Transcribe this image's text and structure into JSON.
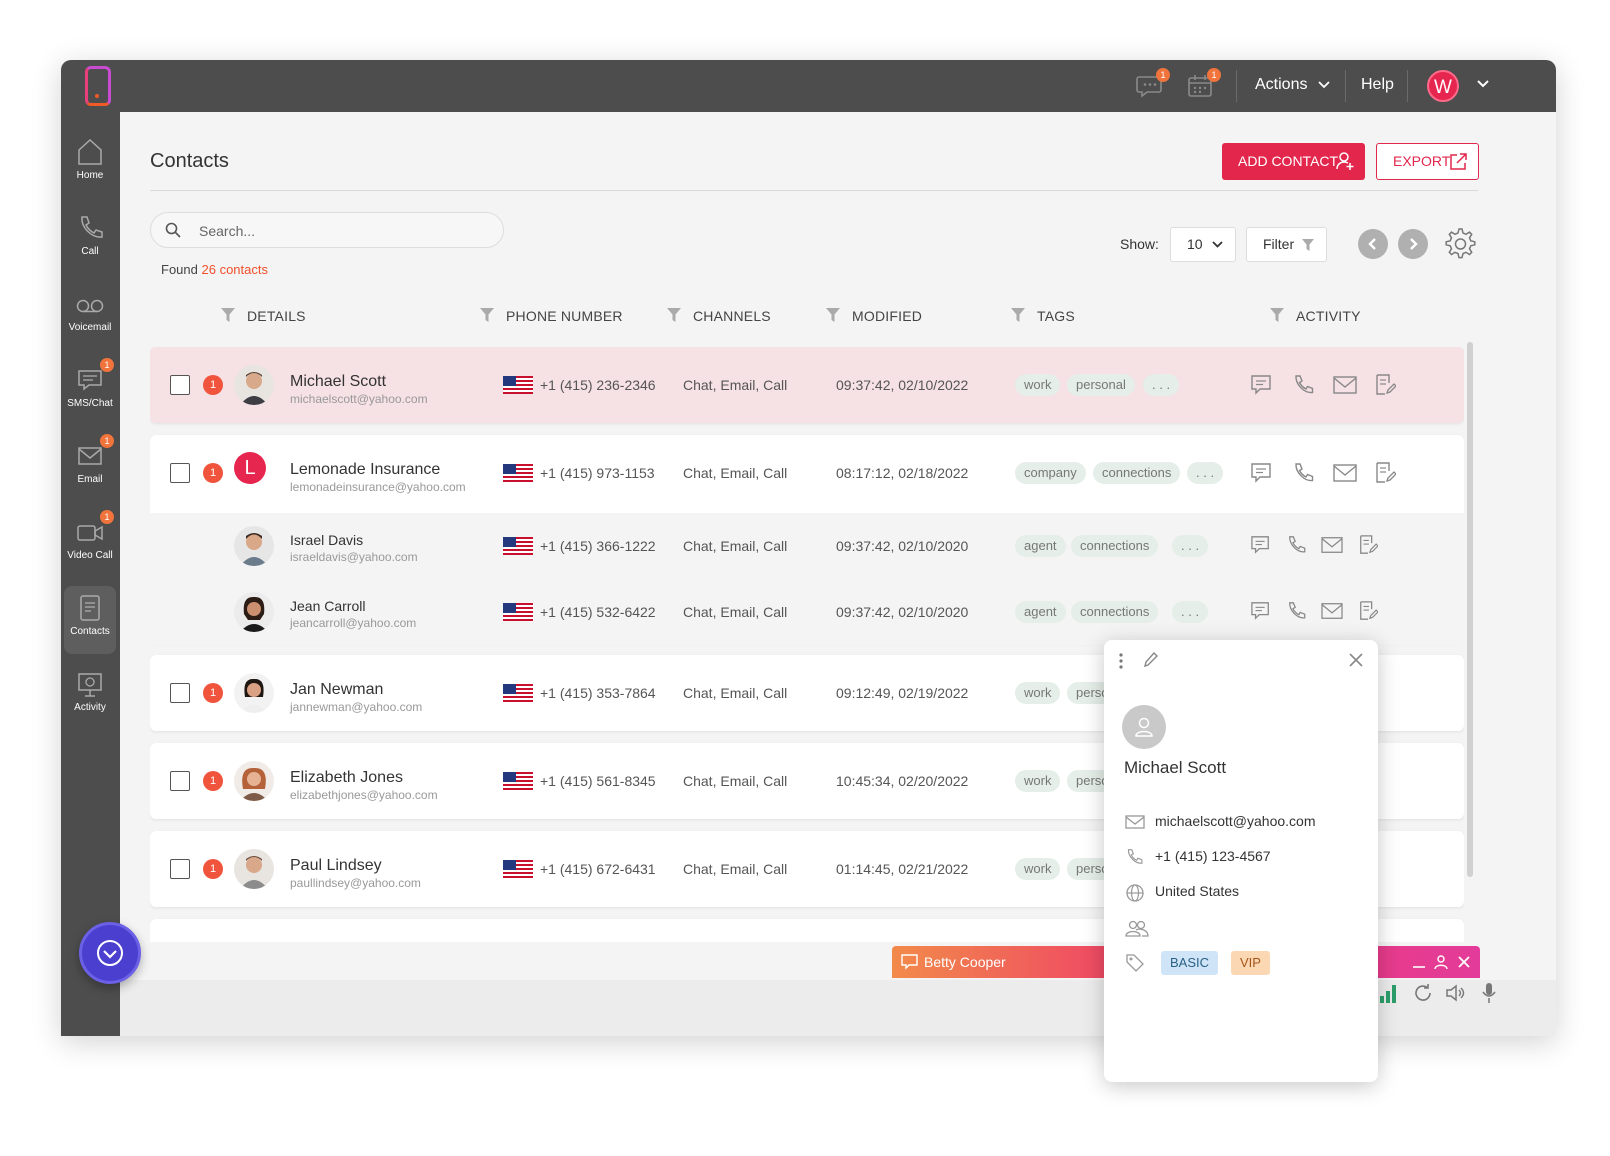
{
  "topbar": {
    "chat_badge": "1",
    "calendar_badge": "1",
    "actions_label": "Actions",
    "help_label": "Help",
    "user_initial": "W"
  },
  "sidebar": {
    "items": [
      {
        "label": "Home",
        "icon": "home-icon",
        "badge": ""
      },
      {
        "label": "Call",
        "icon": "phone-icon",
        "badge": ""
      },
      {
        "label": "Voicemail",
        "icon": "voicemail-icon",
        "badge": ""
      },
      {
        "label": "SMS/Chat",
        "icon": "chat-icon",
        "badge": "1"
      },
      {
        "label": "Email",
        "icon": "email-icon",
        "badge": "1"
      },
      {
        "label": "Video Call",
        "icon": "video-icon",
        "badge": "1"
      },
      {
        "label": "Contacts",
        "icon": "contacts-icon",
        "badge": ""
      },
      {
        "label": "Activity",
        "icon": "activity-icon",
        "badge": ""
      }
    ]
  },
  "page": {
    "title": "Contacts",
    "add_contact_label": "ADD CONTACT",
    "export_label": "EXPORT",
    "search_placeholder": "Search...",
    "found_prefix": "Found",
    "found_count": "26 contacts",
    "show_label": "Show:",
    "show_value": "10",
    "filter_label": "Filter"
  },
  "columns": [
    "DETAILS",
    "PHONE NUMBER",
    "CHANNELS",
    "MODIFIED",
    "TAGS",
    "ACTIVITY"
  ],
  "contacts": [
    {
      "name": "Michael Scott",
      "email": "michaelscott@yahoo.com",
      "phone": "+1 (415) 236-2346",
      "channels": "Chat, Email, Call",
      "modified": "09:37:42, 02/10/2022",
      "tags": [
        "work",
        "personal",
        ". . ."
      ],
      "badge": "1",
      "initial": ""
    },
    {
      "name": "Lemonade Insurance",
      "email": "lemonadeinsurance@yahoo.com",
      "phone": "+1 (415) 973-1153",
      "channels": "Chat, Email, Call",
      "modified": "08:17:12, 02/18/2022",
      "tags": [
        "company",
        "connections",
        ". . ."
      ],
      "badge": "1",
      "initial": "L"
    },
    {
      "name": "Israel Davis",
      "email": "israeldavis@yahoo.com",
      "phone": "+1 (415) 366-1222",
      "channels": "Chat, Email, Call",
      "modified": "09:37:42, 02/10/2020",
      "tags": [
        "agent",
        "connections",
        ". . ."
      ],
      "badge": "",
      "initial": ""
    },
    {
      "name": "Jean Carroll",
      "email": "jeancarroll@yahoo.com",
      "phone": "+1 (415) 532-6422",
      "channels": "Chat, Email, Call",
      "modified": "09:37:42, 02/10/2020",
      "tags": [
        "agent",
        "connections",
        ". . ."
      ],
      "badge": "",
      "initial": ""
    },
    {
      "name": "Jan Newman",
      "email": "jannewman@yahoo.com",
      "phone": "+1 (415) 353-7864",
      "channels": "Chat, Email, Call",
      "modified": "09:12:49, 02/19/2022",
      "tags": [
        "work",
        "perso"
      ],
      "badge": "1",
      "initial": ""
    },
    {
      "name": "Elizabeth Jones",
      "email": "elizabethjones@yahoo.com",
      "phone": "+1 (415) 561-8345",
      "channels": "Chat, Email, Call",
      "modified": "10:45:34, 02/20/2022",
      "tags": [
        "work",
        "perso"
      ],
      "badge": "1",
      "initial": ""
    },
    {
      "name": "Paul Lindsey",
      "email": "paullindsey@yahoo.com",
      "phone": "+1 (415) 672-6431",
      "channels": "Chat, Email, Call",
      "modified": "01:14:45, 02/21/2022",
      "tags": [
        "work",
        "perso"
      ],
      "badge": "1",
      "initial": ""
    }
  ],
  "callbar": {
    "name": "Betty Cooper"
  },
  "popup": {
    "name": "Michael Scott",
    "email": "michaelscott@yahoo.com",
    "phone": "+1 (415) 123-4567",
    "country": "United States",
    "tags": [
      {
        "label": "BASIC",
        "color": "#cfe5f7",
        "text": "#2a5f86"
      },
      {
        "label": "VIP",
        "color": "#fbd7b3",
        "text": "#a4561a"
      }
    ]
  },
  "colors": {
    "accent": "#e2264c",
    "badge": "#f0543c",
    "sidebar": "#4d4d4d",
    "tag_bg": "#e5eee8"
  }
}
